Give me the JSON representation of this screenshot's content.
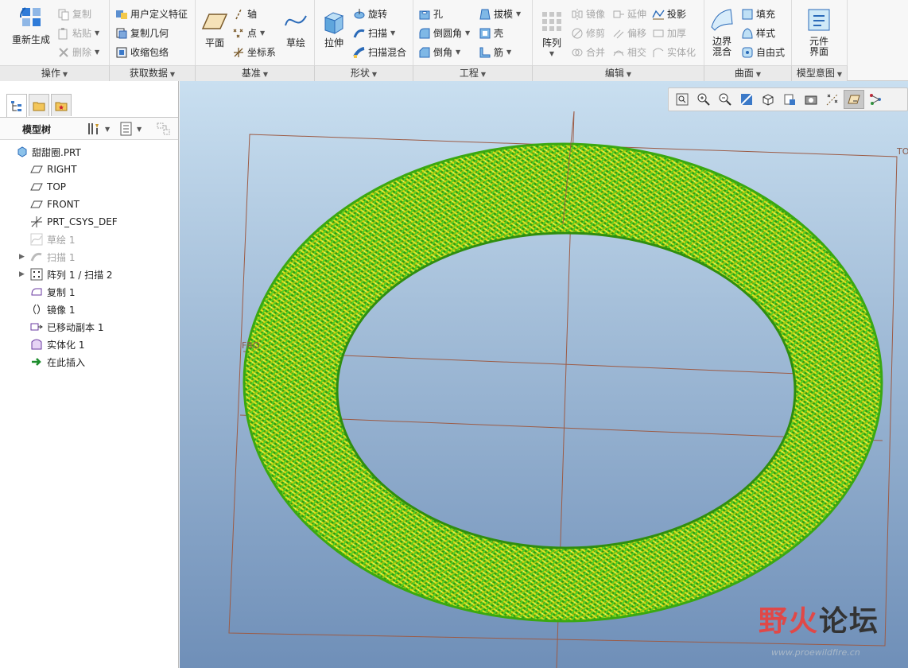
{
  "ribbon": {
    "groups": [
      {
        "label": "操作"
      },
      {
        "label": "获取数据"
      },
      {
        "label": "基准"
      },
      {
        "label": "形状"
      },
      {
        "label": "工程"
      },
      {
        "label": "编辑"
      },
      {
        "label": "曲面"
      },
      {
        "label": "模型意图"
      }
    ],
    "ops": {
      "regenerate": "重新生成",
      "copy": "复制",
      "paste": "粘贴",
      "delete": "删除"
    },
    "getdata": {
      "udf": "用户定义特征",
      "copy_geom": "复制几何",
      "shrinkwrap": "收缩包络"
    },
    "datum": {
      "plane": "平面",
      "axis": "轴",
      "point": "点",
      "csys": "坐标系",
      "sketch": "草绘"
    },
    "shape": {
      "extrude": "拉伸",
      "revolve": "旋转",
      "sweep": "扫描",
      "swept_blend": "扫描混合"
    },
    "engineering": {
      "hole": "孔",
      "round": "倒圆角",
      "chamfer": "倒角",
      "draft": "拔模",
      "shell": "壳",
      "rib": "筋"
    },
    "editing": {
      "pattern": "阵列",
      "mirror": "镜像",
      "trim": "修剪",
      "merge": "合并",
      "extend": "延伸",
      "offset": "偏移",
      "intersect": "相交",
      "project": "投影",
      "thicken": "加厚",
      "solidify": "实体化"
    },
    "surfaces": {
      "boundary_blend_1": "边界",
      "boundary_blend_2": "混合",
      "fill": "填充",
      "style": "样式",
      "freestyle": "自由式"
    },
    "intent": {
      "component_interface_1": "元件",
      "component_interface_2": "界面"
    }
  },
  "sidebar": {
    "title": "模型树",
    "items": [
      {
        "label": "甜甜圈.PRT",
        "icon": "part-icon",
        "dim": false,
        "expand": false
      },
      {
        "label": "RIGHT",
        "icon": "datum-plane-icon",
        "dim": false,
        "expand": false
      },
      {
        "label": "TOP",
        "icon": "datum-plane-icon",
        "dim": false,
        "expand": false
      },
      {
        "label": "FRONT",
        "icon": "datum-plane-icon",
        "dim": false,
        "expand": false
      },
      {
        "label": "PRT_CSYS_DEF",
        "icon": "csys-icon",
        "dim": false,
        "expand": false
      },
      {
        "label": "草绘 1",
        "icon": "sketch-icon",
        "dim": true,
        "expand": false
      },
      {
        "label": "扫描 1",
        "icon": "sweep-icon",
        "dim": true,
        "expand": true
      },
      {
        "label": "阵列 1 / 扫描 2",
        "icon": "pattern-icon",
        "dim": false,
        "expand": true
      },
      {
        "label": "复制 1",
        "icon": "copy-icon",
        "dim": false,
        "expand": false
      },
      {
        "label": "镜像 1",
        "icon": "mirror-icon",
        "dim": false,
        "expand": false
      },
      {
        "label": "已移动副本 1",
        "icon": "moved-copy-icon",
        "dim": false,
        "expand": false
      },
      {
        "label": "实体化 1",
        "icon": "solidify-icon",
        "dim": false,
        "expand": false
      },
      {
        "label": "在此插入",
        "icon": "insert-here-icon",
        "dim": false,
        "expand": false
      }
    ]
  },
  "viewport": {
    "datum_labels": {
      "top_right": "TO",
      "left": "FRO"
    },
    "watermark": {
      "part1": "野火",
      "part2": "论坛",
      "url": "www.proewildfire.cn"
    }
  },
  "colors": {
    "torus_green": "#3fbf1a",
    "torus_yellow": "#d8d80a",
    "datum_line": "#9c5b45"
  }
}
